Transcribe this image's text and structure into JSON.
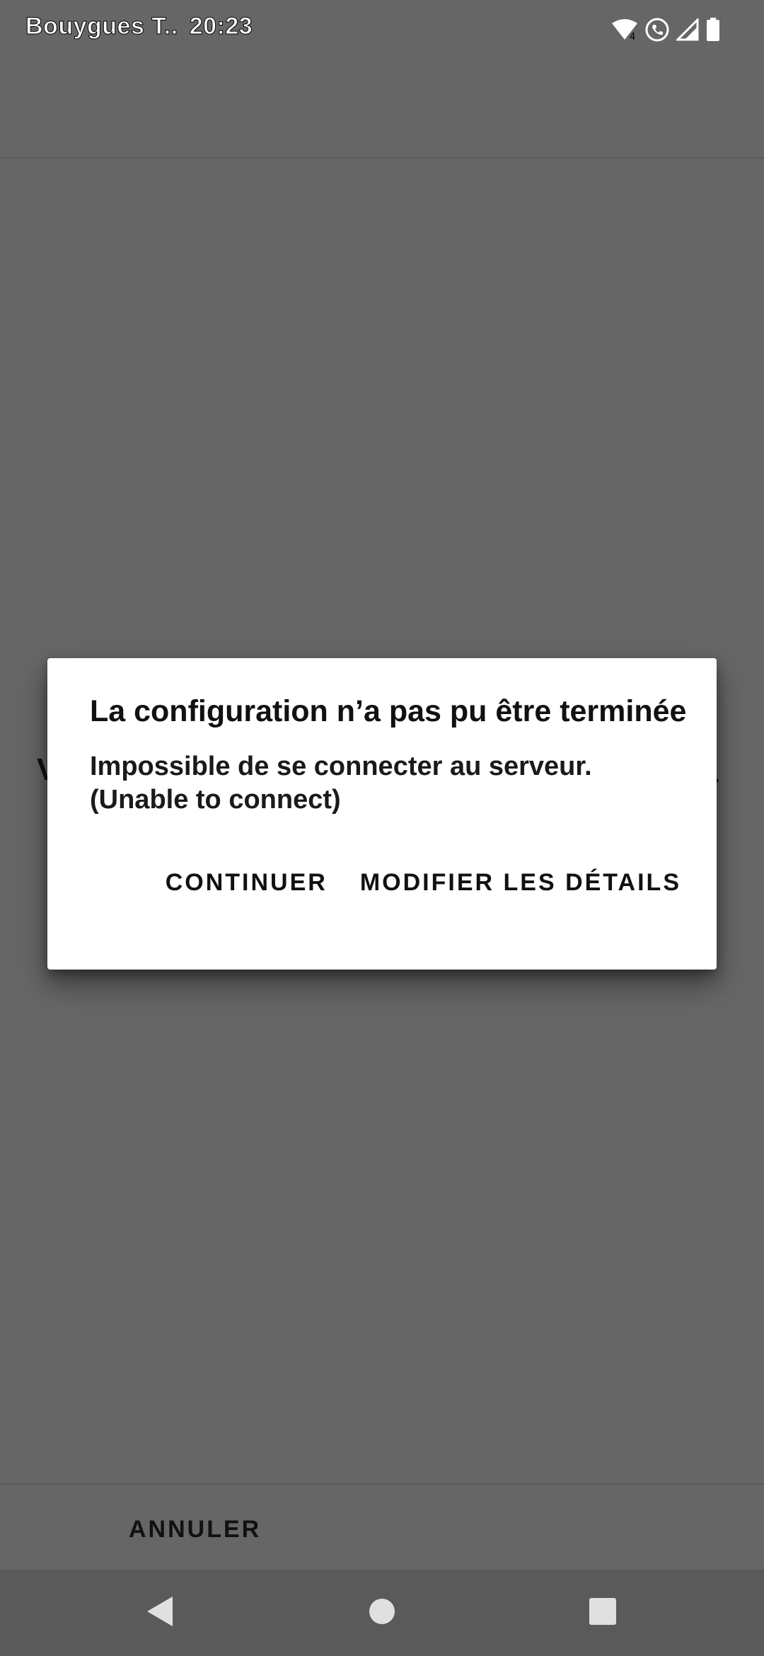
{
  "status_bar": {
    "carrier": "Bouygues T..",
    "time": "20:23",
    "icons": [
      "wifi-calling-icon",
      "volte-icon",
      "signal-icon",
      "battery-icon"
    ]
  },
  "background": {
    "left_text": "V",
    "right_text": "."
  },
  "dialog": {
    "title": "La configuration n’a pas pu être terminée",
    "message_line1": "Impossible de se connecter au serveur.",
    "message_line2": "(Unable to connect)",
    "continue_label": "CONTINUER",
    "edit_details_label": "MODIFIER LES DÉTAILS"
  },
  "bottom_bar": {
    "cancel_label": "ANNULER"
  },
  "nav_bar": {
    "icons": [
      "back-icon",
      "home-icon",
      "recents-icon"
    ]
  },
  "colors": {
    "scrim": "#666666",
    "dialog_bg": "#ffffff",
    "text": "#111111"
  }
}
